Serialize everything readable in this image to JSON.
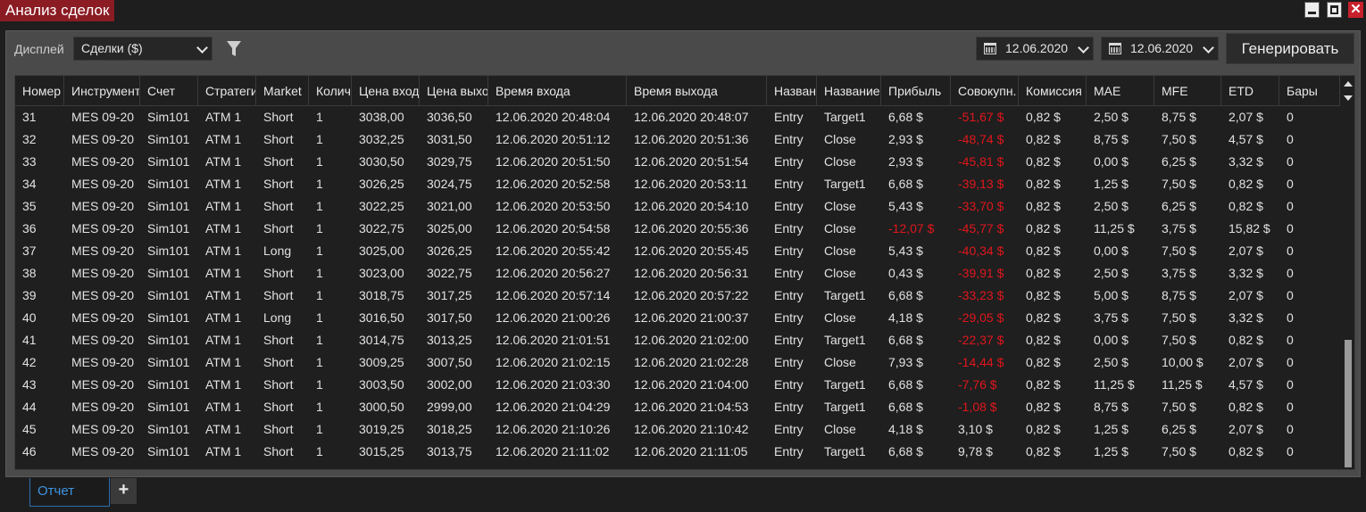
{
  "window": {
    "title": "Анализ сделок",
    "buttons": [
      "minimize-icon",
      "maximize-icon",
      "close-icon"
    ],
    "close_glyph": "✕",
    "accent_color": "#8b1c24"
  },
  "toolbar": {
    "display_label": "Дисплей",
    "display_value": "Сделки ($)",
    "filter_icon": "filter-icon",
    "date_from": "12.06.2020",
    "date_to": "12.06.2020",
    "generate_label": "Генерировать"
  },
  "grid": {
    "columns": [
      "Номер",
      "Инструмент",
      "Счет",
      "Стратегия",
      "Market",
      "Количество",
      "Цена входа",
      "Цена выхода",
      "Время входа",
      "Время выхода",
      "Название",
      "Название",
      "Прибыль",
      "Совокупн.",
      "Комиссия",
      "MAE",
      "MFE",
      "ETD",
      "Бары"
    ],
    "negative_color": "#e0161c",
    "rows": [
      [
        "31",
        "MES 09-20",
        "Sim101",
        "ATM 1",
        "Short",
        "1",
        "3038,00",
        "3036,50",
        "12.06.2020 20:48:04",
        "12.06.2020 20:48:07",
        "Entry",
        "Target1",
        "6,68 $",
        "-51,67 $",
        "0,82 $",
        "2,50 $",
        "8,75 $",
        "2,07 $",
        "0"
      ],
      [
        "32",
        "MES 09-20",
        "Sim101",
        "ATM 1",
        "Short",
        "1",
        "3032,25",
        "3031,50",
        "12.06.2020 20:51:12",
        "12.06.2020 20:51:36",
        "Entry",
        "Close",
        "2,93 $",
        "-48,74 $",
        "0,82 $",
        "8,75 $",
        "7,50 $",
        "4,57 $",
        "0"
      ],
      [
        "33",
        "MES 09-20",
        "Sim101",
        "ATM 1",
        "Short",
        "1",
        "3030,50",
        "3029,75",
        "12.06.2020 20:51:50",
        "12.06.2020 20:51:54",
        "Entry",
        "Close",
        "2,93 $",
        "-45,81 $",
        "0,82 $",
        "0,00 $",
        "6,25 $",
        "3,32 $",
        "0"
      ],
      [
        "34",
        "MES 09-20",
        "Sim101",
        "ATM 1",
        "Short",
        "1",
        "3026,25",
        "3024,75",
        "12.06.2020 20:52:58",
        "12.06.2020 20:53:11",
        "Entry",
        "Target1",
        "6,68 $",
        "-39,13 $",
        "0,82 $",
        "1,25 $",
        "7,50 $",
        "0,82 $",
        "0"
      ],
      [
        "35",
        "MES 09-20",
        "Sim101",
        "ATM 1",
        "Short",
        "1",
        "3022,25",
        "3021,00",
        "12.06.2020 20:53:50",
        "12.06.2020 20:54:10",
        "Entry",
        "Close",
        "5,43 $",
        "-33,70 $",
        "0,82 $",
        "2,50 $",
        "6,25 $",
        "0,82 $",
        "0"
      ],
      [
        "36",
        "MES 09-20",
        "Sim101",
        "ATM 1",
        "Short",
        "1",
        "3022,75",
        "3025,00",
        "12.06.2020 20:54:58",
        "12.06.2020 20:55:36",
        "Entry",
        "Close",
        "-12,07 $",
        "-45,77 $",
        "0,82 $",
        "11,25 $",
        "3,75 $",
        "15,82 $",
        "0"
      ],
      [
        "37",
        "MES 09-20",
        "Sim101",
        "ATM 1",
        "Long",
        "1",
        "3025,00",
        "3026,25",
        "12.06.2020 20:55:42",
        "12.06.2020 20:55:45",
        "Entry",
        "Close",
        "5,43 $",
        "-40,34 $",
        "0,82 $",
        "0,00 $",
        "7,50 $",
        "2,07 $",
        "0"
      ],
      [
        "38",
        "MES 09-20",
        "Sim101",
        "ATM 1",
        "Short",
        "1",
        "3023,00",
        "3022,75",
        "12.06.2020 20:56:27",
        "12.06.2020 20:56:31",
        "Entry",
        "Close",
        "0,43 $",
        "-39,91 $",
        "0,82 $",
        "2,50 $",
        "3,75 $",
        "3,32 $",
        "0"
      ],
      [
        "39",
        "MES 09-20",
        "Sim101",
        "ATM 1",
        "Short",
        "1",
        "3018,75",
        "3017,25",
        "12.06.2020 20:57:14",
        "12.06.2020 20:57:22",
        "Entry",
        "Target1",
        "6,68 $",
        "-33,23 $",
        "0,82 $",
        "5,00 $",
        "8,75 $",
        "2,07 $",
        "0"
      ],
      [
        "40",
        "MES 09-20",
        "Sim101",
        "ATM 1",
        "Long",
        "1",
        "3016,50",
        "3017,50",
        "12.06.2020 21:00:26",
        "12.06.2020 21:00:37",
        "Entry",
        "Close",
        "4,18 $",
        "-29,05 $",
        "0,82 $",
        "3,75 $",
        "7,50 $",
        "3,32 $",
        "0"
      ],
      [
        "41",
        "MES 09-20",
        "Sim101",
        "ATM 1",
        "Short",
        "1",
        "3014,75",
        "3013,25",
        "12.06.2020 21:01:51",
        "12.06.2020 21:02:00",
        "Entry",
        "Target1",
        "6,68 $",
        "-22,37 $",
        "0,82 $",
        "0,00 $",
        "7,50 $",
        "0,82 $",
        "0"
      ],
      [
        "42",
        "MES 09-20",
        "Sim101",
        "ATM 1",
        "Short",
        "1",
        "3009,25",
        "3007,50",
        "12.06.2020 21:02:15",
        "12.06.2020 21:02:28",
        "Entry",
        "Close",
        "7,93 $",
        "-14,44 $",
        "0,82 $",
        "2,50 $",
        "10,00 $",
        "2,07 $",
        "0"
      ],
      [
        "43",
        "MES 09-20",
        "Sim101",
        "ATM 1",
        "Short",
        "1",
        "3003,50",
        "3002,00",
        "12.06.2020 21:03:30",
        "12.06.2020 21:04:00",
        "Entry",
        "Target1",
        "6,68 $",
        "-7,76 $",
        "0,82 $",
        "11,25 $",
        "11,25 $",
        "4,57 $",
        "0"
      ],
      [
        "44",
        "MES 09-20",
        "Sim101",
        "ATM 1",
        "Short",
        "1",
        "3000,50",
        "2999,00",
        "12.06.2020 21:04:29",
        "12.06.2020 21:04:53",
        "Entry",
        "Target1",
        "6,68 $",
        "-1,08 $",
        "0,82 $",
        "8,75 $",
        "7,50 $",
        "0,82 $",
        "0"
      ],
      [
        "45",
        "MES 09-20",
        "Sim101",
        "ATM 1",
        "Short",
        "1",
        "3019,25",
        "3018,25",
        "12.06.2020 21:10:26",
        "12.06.2020 21:10:42",
        "Entry",
        "Close",
        "4,18 $",
        "3,10 $",
        "0,82 $",
        "1,25 $",
        "6,25 $",
        "2,07 $",
        "0"
      ],
      [
        "46",
        "MES 09-20",
        "Sim101",
        "ATM 1",
        "Short",
        "1",
        "3015,25",
        "3013,75",
        "12.06.2020 21:11:02",
        "12.06.2020 21:11:05",
        "Entry",
        "Target1",
        "6,68 $",
        "9,78 $",
        "0,82 $",
        "1,25 $",
        "7,50 $",
        "0,82 $",
        "0"
      ]
    ]
  },
  "tabs": {
    "active_label": "Отчет",
    "add_label": "+"
  }
}
